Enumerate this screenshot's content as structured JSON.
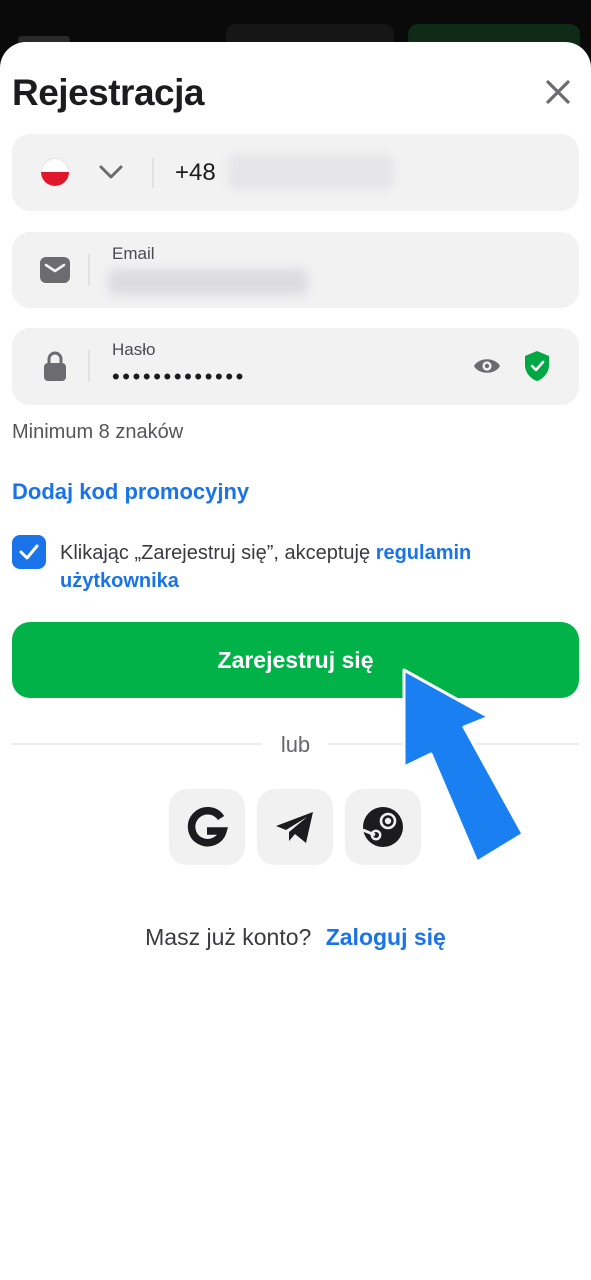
{
  "dialog": {
    "title": "Rejestracja"
  },
  "phone": {
    "code": "+48"
  },
  "email": {
    "label": "Email"
  },
  "password": {
    "label": "Hasło",
    "masked_value": "•••••••••••••",
    "hint": "Minimum 8 znaków"
  },
  "promo": {
    "label": "Dodaj kod promocyjny"
  },
  "terms": {
    "text": "Klikając „Zarejestruj się”, akceptuję",
    "link": "regulamin użytkownika",
    "checked": true
  },
  "submit": {
    "label": "Zarejestruj się"
  },
  "divider": {
    "label": "lub"
  },
  "social": [
    "google-icon",
    "telegram-icon",
    "steam-icon"
  ],
  "footer": {
    "question": "Masz już konto?",
    "link": "Zaloguj się"
  },
  "colors": {
    "accent": "#1a73e8",
    "primary_button": "#00b247",
    "field_bg": "#f2f2f3",
    "shield": "#00a843"
  }
}
